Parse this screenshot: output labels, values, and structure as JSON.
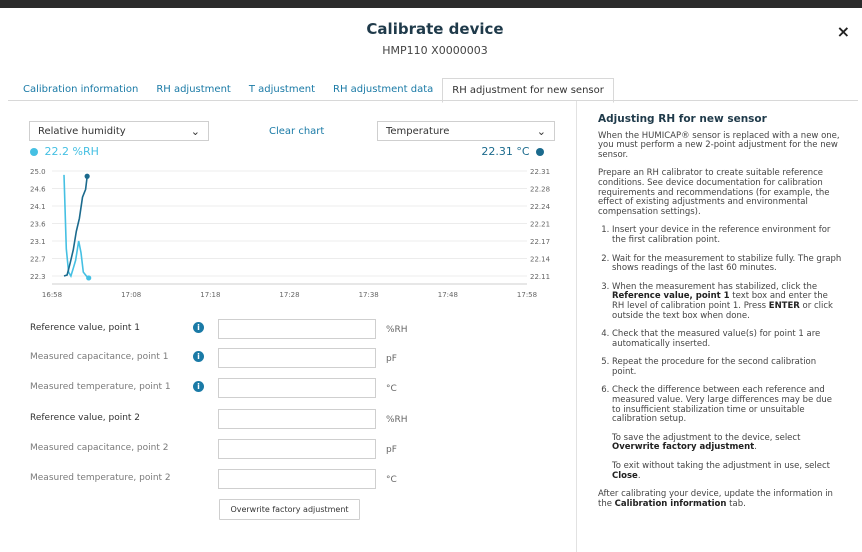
{
  "dialog": {
    "title": "Calibrate device",
    "subtitle": "HMP110 X0000003",
    "close_label": "×"
  },
  "tabs": [
    {
      "label": "Calibration information",
      "active": false
    },
    {
      "label": "RH adjustment",
      "active": false
    },
    {
      "label": "T adjustment",
      "active": false
    },
    {
      "label": "RH adjustment data",
      "active": false
    },
    {
      "label": "RH adjustment for new sensor",
      "active": true
    }
  ],
  "chart_controls": {
    "left_select": "Relative humidity",
    "clear_chart": "Clear chart",
    "right_select": "Temperature",
    "left_reading": "22.2 %RH",
    "right_reading": "22.31 °C"
  },
  "chart_data": {
    "type": "line",
    "x_ticks": [
      "16:58",
      "17:08",
      "17:18",
      "17:28",
      "17:38",
      "17:48",
      "17:58"
    ],
    "y_left_ticks": [
      "25.0",
      "24.6",
      "24.1",
      "23.6",
      "23.1",
      "22.7",
      "22.3"
    ],
    "y_right_ticks": [
      "22.31",
      "22.28",
      "22.24",
      "22.21",
      "22.17",
      "22.14",
      "22.11"
    ],
    "y_left_range": [
      22.3,
      25.0
    ],
    "y_right_range": [
      22.11,
      22.31
    ],
    "x_range_minutes": [
      0,
      60
    ],
    "series": [
      {
        "color": "#45c0e3",
        "axis": "left",
        "points": [
          [
            0.0,
            24.9
          ],
          [
            0.3,
            23.0
          ],
          [
            0.6,
            22.4
          ],
          [
            0.9,
            22.3
          ],
          [
            1.2,
            22.5
          ],
          [
            1.5,
            22.7
          ],
          [
            1.9,
            23.2
          ],
          [
            2.2,
            22.9
          ],
          [
            2.5,
            22.4
          ],
          [
            2.9,
            22.3
          ],
          [
            3.2,
            22.25
          ]
        ]
      },
      {
        "color": "#1b6a8d",
        "axis": "right",
        "points": [
          [
            0.0,
            22.11
          ],
          [
            0.4,
            22.112
          ],
          [
            0.8,
            22.135
          ],
          [
            1.2,
            22.16
          ],
          [
            1.6,
            22.195
          ],
          [
            2.0,
            22.22
          ],
          [
            2.4,
            22.26
          ],
          [
            2.8,
            22.275
          ],
          [
            3.0,
            22.3
          ]
        ]
      }
    ]
  },
  "form": {
    "rows": [
      {
        "label": "Reference value, point 1",
        "unit": "%RH",
        "info": true,
        "kind": "reference"
      },
      {
        "label": "Measured capacitance, point 1",
        "unit": "pF",
        "info": true,
        "kind": "measured"
      },
      {
        "label": "Measured temperature, point 1",
        "unit": "°C",
        "info": true,
        "kind": "measured"
      },
      {
        "label": "Reference value, point 2",
        "unit": "%RH",
        "info": false,
        "kind": "reference"
      },
      {
        "label": "Measured capacitance, point 2",
        "unit": "pF",
        "info": false,
        "kind": "measured"
      },
      {
        "label": "Measured temperature, point 2",
        "unit": "°C",
        "info": false,
        "kind": "measured"
      }
    ],
    "button": "Overwrite factory adjustment"
  },
  "help": {
    "title": "Adjusting RH for new sensor",
    "intro1": "When the HUMICAP® sensor is replaced with a new one, you must perform a new 2-point adjustment for the new sensor.",
    "intro2": "Prepare an RH calibrator to create suitable reference conditions. See device documentation for calibration requirements and recommendations (for example, the effect of existing adjustments and environmental compensation settings).",
    "step1": "Insert your device in the reference environment for the first calibration point.",
    "step2": "Wait for the measurement to stabilize fully. The graph shows readings of the last 60 minutes.",
    "step3_a": "When the measurement has stabilized, click the ",
    "step3_b": "Reference value, point 1",
    "step3_c": " text box and enter the RH level of calibration point 1. Press ",
    "step3_d": "ENTER",
    "step3_e": " or click outside the text box when done.",
    "step4": "Check that the measured value(s) for point 1 are automatically inserted.",
    "step5": "Repeat the procedure for the second calibration point.",
    "step6": "Check the difference between each reference and measured value. Very large differences may be due to insufficient stabilization time or unsuitable calibration setup.",
    "save_a": "To save the adjustment to the device, select ",
    "save_b": "Overwrite factory adjustment",
    "save_c": ".",
    "exit_a": "To exit without taking the adjustment in use, select ",
    "exit_b": "Close",
    "exit_c": ".",
    "outro_a": "After calibrating your device, update the information in the ",
    "outro_b": "Calibration information",
    "outro_c": " tab."
  }
}
